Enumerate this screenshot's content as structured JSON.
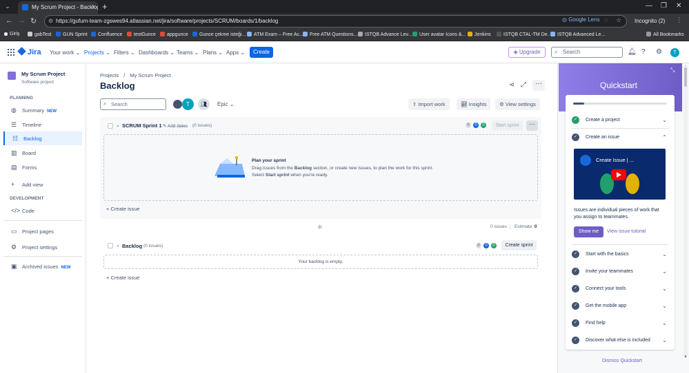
{
  "browser": {
    "tab_title": "My Scrum Project - Backlog - Ji",
    "url": "https://gufum-team-zgswes94.atlassian.net/jira/software/projects/SCRUM/boards/1/backlog",
    "lens_label": "Google Lens",
    "incognito_label": "Incognito (2)",
    "bookmarks": [
      "Giriş",
      "gabTest",
      "GUN Sprint",
      "Confluence",
      "testGunce",
      "appgunce",
      "Gunce çekme isteği...",
      "ATM Exam – Free Ac...",
      "Free ATM Questions...",
      "ISTQB Advance Lev...",
      "User avatar Icons &...",
      "Jenkins",
      "ISTQB CTAL-TM De...",
      "ISTQB Advanced Le..."
    ],
    "all_bookmarks": "All Bookmarks"
  },
  "topnav": {
    "logo": "Jira",
    "items": [
      "Your work",
      "Projects",
      "Filters",
      "Dashboards",
      "Teams",
      "Plans",
      "Apps"
    ],
    "create": "Create",
    "upgrade": "Upgrade",
    "search_placeholder": "Search",
    "avatar_initial": "T"
  },
  "sidebar": {
    "project_name": "My Scrum Project",
    "project_type": "Software project",
    "planning_label": "PLANNING",
    "planning_items": [
      {
        "label": "Summary",
        "badge": "NEW"
      },
      {
        "label": "Timeline"
      },
      {
        "label": "Backlog"
      },
      {
        "label": "Board"
      },
      {
        "label": "Forms"
      }
    ],
    "add_view": "Add view",
    "development_label": "DEVELOPMENT",
    "code": "Code",
    "project_pages": "Project pages",
    "project_settings": "Project settings",
    "archived_issues": "Archived issues",
    "archived_badge": "NEW"
  },
  "main": {
    "breadcrumb_projects": "Projects",
    "breadcrumb_sep": "/",
    "breadcrumb_project": "My Scrum Project",
    "title": "Backlog",
    "search_placeholder": "Search",
    "avatar_initial": "T",
    "epic_label": "Epic",
    "import_work": "Import work",
    "insights": "Insights",
    "view_settings": "View settings",
    "sprint": {
      "name": "SCRUM Sprint 1",
      "add_dates": "Add dates",
      "issue_count": "(0 issues)",
      "counts": [
        "0",
        "0",
        "0"
      ],
      "start_sprint": "Start sprint",
      "plan_title": "Plan your sprint",
      "plan_line1_pre": "Drag issues from the ",
      "plan_line1_bold": "Backlog",
      "plan_line1_post": " section, or create new issues, to plan the work for this sprint.",
      "plan_line2_pre": "Select ",
      "plan_line2_bold": "Start sprint",
      "plan_line2_post": " when you're ready.",
      "create_issue": "Create issue",
      "footer_issues": "0 issues",
      "footer_estimate_label": "Estimate:",
      "footer_estimate_value": "0"
    },
    "backlog": {
      "name": "Backlog",
      "issue_count": "(0 issues)",
      "counts": [
        "0",
        "0",
        "0"
      ],
      "create_sprint": "Create sprint",
      "empty_text": "Your backlog is empty.",
      "create_issue": "Create issue"
    }
  },
  "quickstart": {
    "title": "Quickstart",
    "progress": 0.12,
    "items": [
      {
        "label": "Create a project",
        "done": true,
        "expanded": false
      },
      {
        "label": "Create an issue",
        "done": false,
        "expanded": true
      },
      {
        "label": "Start with the basics",
        "done": false,
        "expanded": false
      },
      {
        "label": "Invite your teammates",
        "done": false,
        "expanded": false
      },
      {
        "label": "Connect your tools",
        "done": false,
        "expanded": false
      },
      {
        "label": "Get the mobile app",
        "done": false,
        "expanded": false
      },
      {
        "label": "Find help",
        "done": false,
        "expanded": false
      },
      {
        "label": "Discover what else is included",
        "done": false,
        "expanded": false
      }
    ],
    "video_title": "Create Issue | ...",
    "description_line1": "Issues are individual pieces of work that",
    "description_line2": "you assign to teammates.",
    "show_me": "Show me",
    "view_tutorial": "View issue tutorial",
    "dismiss": "Dismiss Quickstart"
  },
  "colors": {
    "brand": "#1868db",
    "accent": "#0c66e4",
    "quickstart": "#6e5dc6",
    "done": "#22a06b"
  }
}
